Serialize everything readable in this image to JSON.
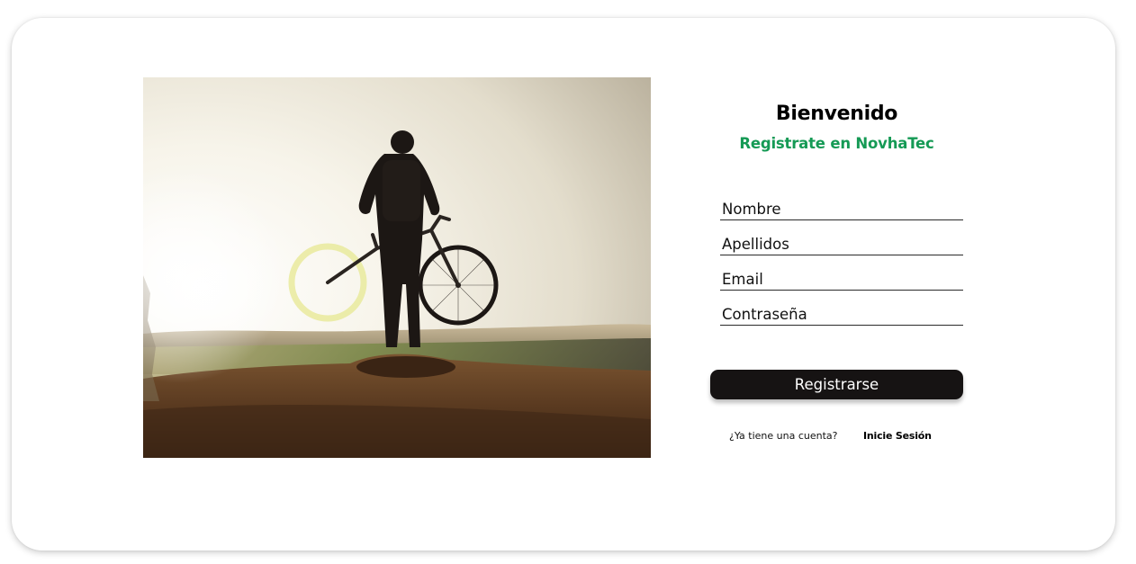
{
  "header": {
    "title": "Bienvenido",
    "subtitle": "Registrate en NovhaTec"
  },
  "form": {
    "fields": [
      {
        "placeholder": "Nombre",
        "value": ""
      },
      {
        "placeholder": "Apellidos",
        "value": ""
      },
      {
        "placeholder": "Email",
        "value": ""
      },
      {
        "placeholder": "Contraseña",
        "value": ""
      }
    ],
    "submit_label": "Registrarse"
  },
  "footer": {
    "question": "¿Ya tiene una cuenta?",
    "login_link": "Inicie Sesión"
  },
  "image": {
    "description_icon": "cyclist-sunset-photo"
  },
  "colors": {
    "accent": "#159a55",
    "button_bg": "#161313",
    "button_text": "#ffffff"
  }
}
